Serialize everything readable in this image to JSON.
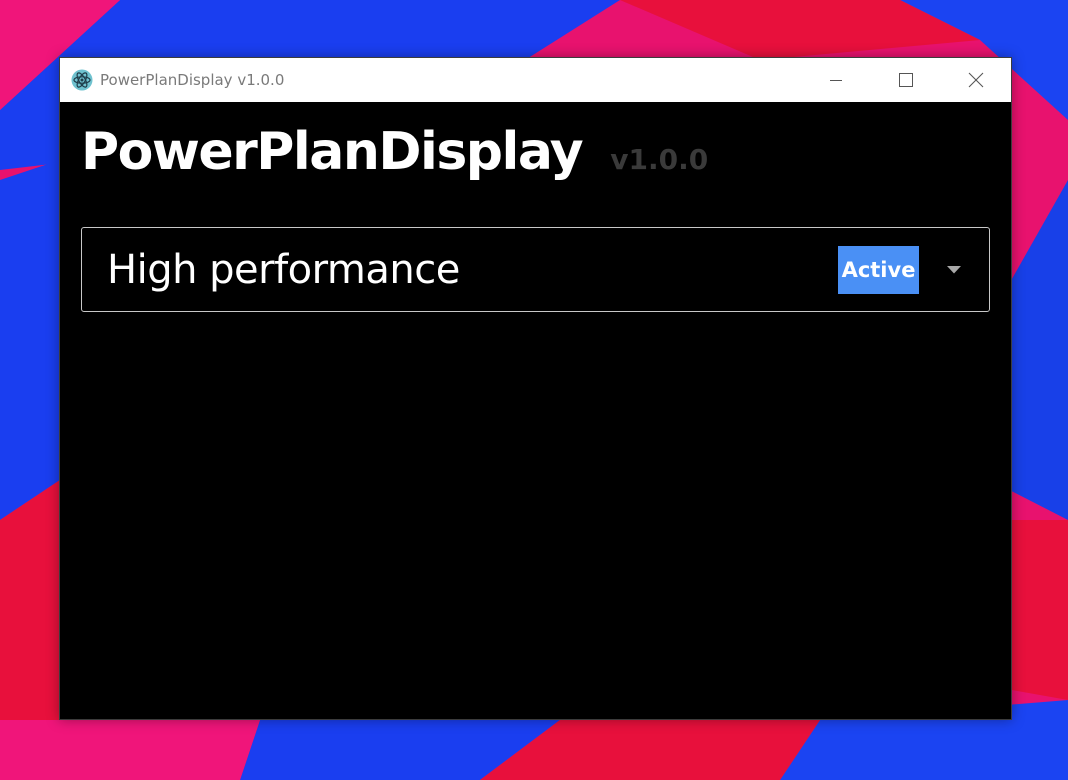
{
  "window": {
    "title": "PowerPlanDisplay v1.0.0",
    "app_icon": "atom-icon",
    "controls": {
      "minimize": "minimize-icon",
      "maximize": "maximize-icon",
      "close": "close-icon"
    }
  },
  "header": {
    "app_name": "PowerPlanDisplay",
    "version": "v1.0.0"
  },
  "power_plan": {
    "selected": "High performance",
    "status": "Active",
    "dropdown_icon": "caret-down-icon"
  },
  "colors": {
    "background": "#000000",
    "titlebar": "#ffffff",
    "badge": "#4a90f5",
    "version_text": "#3a3a3a",
    "wallpaper_pink": "#f0157a",
    "wallpaper_blue": "#1a3ef0",
    "wallpaper_red": "#e8103c"
  }
}
